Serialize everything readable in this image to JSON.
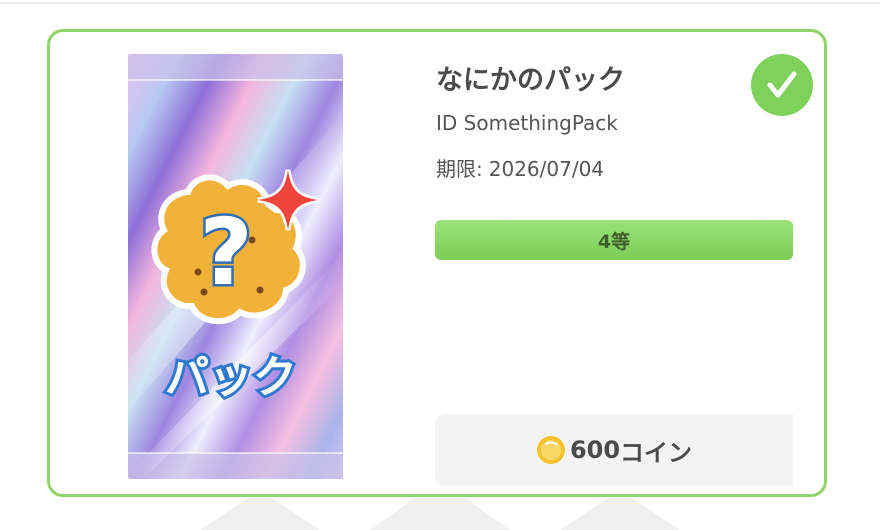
{
  "pack": {
    "title": "なにかのパック",
    "id_text": "ID SomethingPack",
    "expiry_label": "期限:",
    "expiry_date": "2026/07/04",
    "rank": "4等",
    "image_label": "パック",
    "selected": true
  },
  "price": {
    "amount": "600",
    "unit": "コイン"
  },
  "colors": {
    "card_border": "#8fd46a",
    "check_bg": "#7ed15a",
    "rank_bar": "#8ad865",
    "price_bg": "#f3f3f3",
    "coin": "#f5c22e"
  },
  "icons": {
    "check": "checkmark-icon",
    "coin": "coin-icon",
    "mystery": "question-cookie-icon",
    "sparkle": "sparkle-icon"
  }
}
